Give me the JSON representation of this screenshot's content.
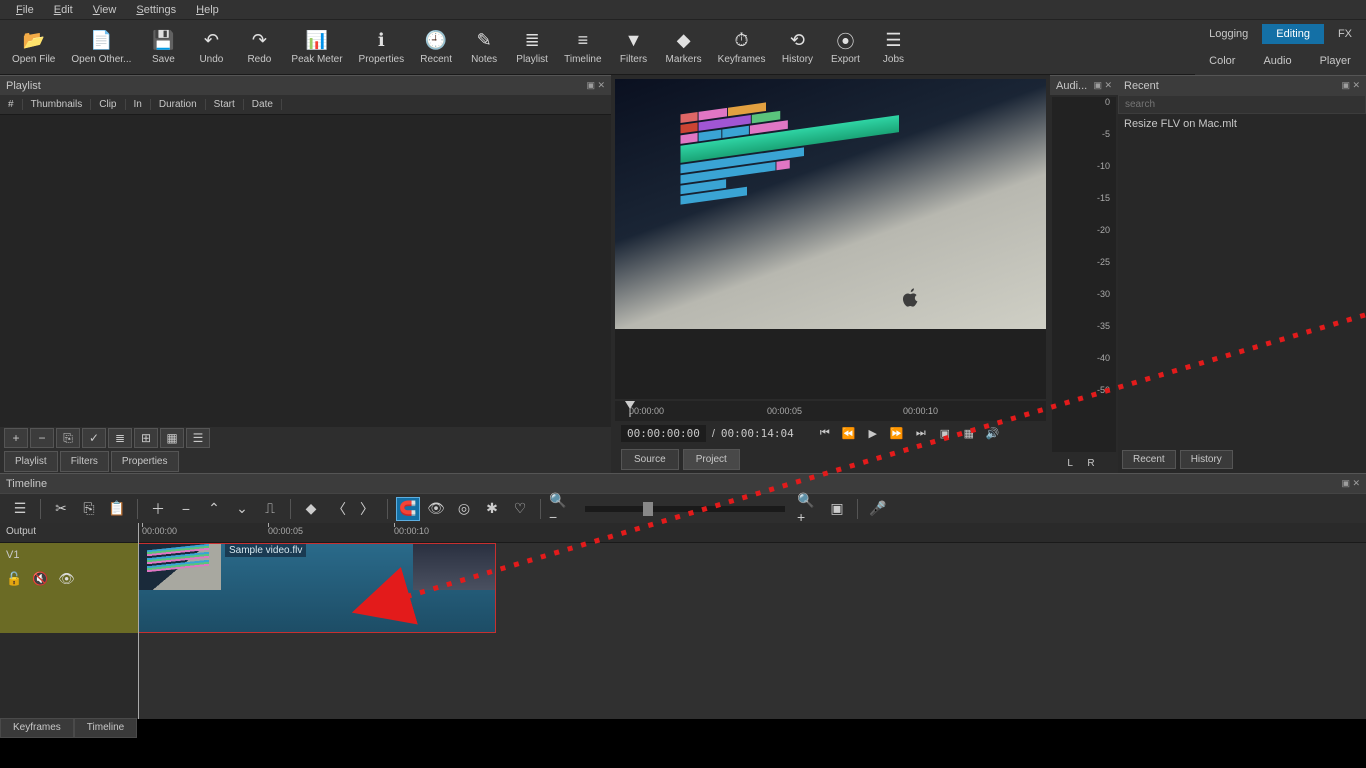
{
  "menubar": [
    "File",
    "Edit",
    "View",
    "Settings",
    "Help"
  ],
  "toolbar": [
    {
      "icon": "📂",
      "label": "Open File"
    },
    {
      "icon": "📄",
      "label": "Open Other..."
    },
    {
      "icon": "💾",
      "label": "Save"
    },
    {
      "icon": "↶",
      "label": "Undo"
    },
    {
      "icon": "↷",
      "label": "Redo"
    },
    {
      "icon": "📊",
      "label": "Peak Meter"
    },
    {
      "icon": "ℹ",
      "label": "Properties"
    },
    {
      "icon": "🕘",
      "label": "Recent"
    },
    {
      "icon": "✎",
      "label": "Notes"
    },
    {
      "icon": "≣",
      "label": "Playlist"
    },
    {
      "icon": "≡",
      "label": "Timeline"
    },
    {
      "icon": "▼",
      "label": "Filters"
    },
    {
      "icon": "◆",
      "label": "Markers"
    },
    {
      "icon": "⏱",
      "label": "Keyframes"
    },
    {
      "icon": "⟲",
      "label": "History"
    },
    {
      "icon": "⦿",
      "label": "Export"
    },
    {
      "icon": "☰",
      "label": "Jobs"
    }
  ],
  "layout_tabs": {
    "row1": [
      "Logging",
      "Editing",
      "FX"
    ],
    "active1": "Editing",
    "row2": [
      "Color",
      "Audio",
      "Player"
    ]
  },
  "playlist": {
    "title": "Playlist",
    "columns": [
      "#",
      "Thumbnails",
      "Clip",
      "In",
      "Duration",
      "Start",
      "Date"
    ]
  },
  "playlist_actions": {
    "buttons": [
      "+",
      "−",
      "⎘",
      "✓",
      "≣",
      "⊞",
      "▦",
      "☰"
    ],
    "tabs": [
      "Playlist",
      "Filters",
      "Properties"
    ]
  },
  "preview": {
    "scrub": [
      "00:00:00",
      "00:00:05",
      "00:00:10"
    ],
    "time_current": "00:00:00:00",
    "time_total": "00:00:14:04",
    "tabs": [
      "Source",
      "Project"
    ],
    "active_tab": "Project"
  },
  "audio_meter": {
    "title": "Audi...",
    "ticks": [
      "0",
      "-5",
      "-10",
      "-15",
      "-20",
      "-25",
      "-30",
      "-35",
      "-40",
      "-50"
    ],
    "lr": "L  R"
  },
  "recent": {
    "title": "Recent",
    "search_placeholder": "search",
    "items": [
      "Resize FLV on Mac.mlt"
    ],
    "tabs": [
      "Recent",
      "History"
    ]
  },
  "timeline": {
    "title": "Timeline",
    "output": "Output",
    "track": "V1",
    "ruler": [
      "00:00:00",
      "00:00:05",
      "00:00:10"
    ],
    "clip_name": "Sample video.flv"
  },
  "bottom_tabs": [
    "Keyframes",
    "Timeline"
  ]
}
